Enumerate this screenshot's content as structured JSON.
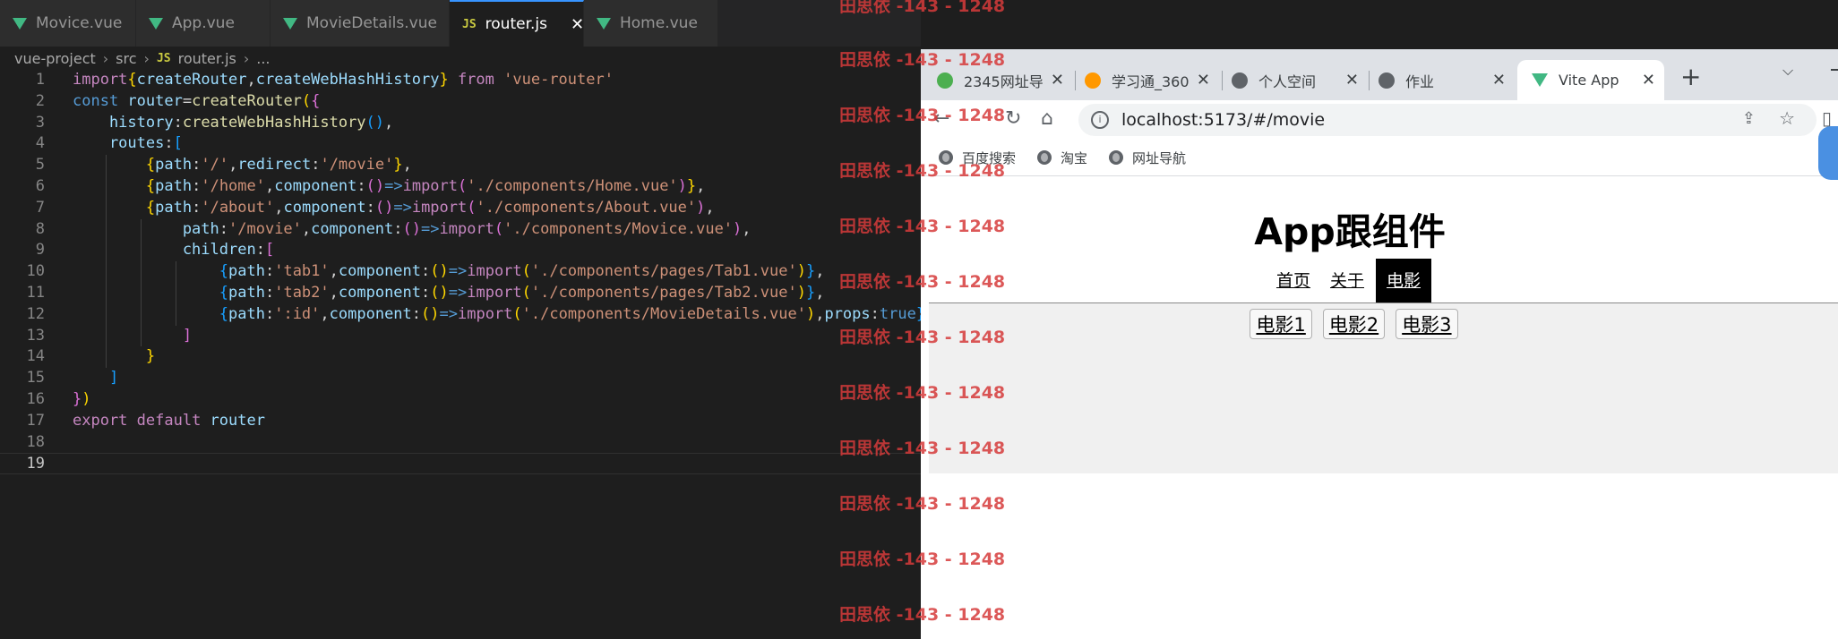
{
  "editor": {
    "tabs": [
      {
        "label": "Movice.vue",
        "icon": "vue-icon"
      },
      {
        "label": "App.vue",
        "icon": "vue-icon"
      },
      {
        "label": "MovieDetails.vue",
        "icon": "vue-icon"
      },
      {
        "label": "router.js",
        "icon": "js-icon",
        "active": true
      },
      {
        "label": "Home.vue",
        "icon": "vue-icon"
      }
    ],
    "breadcrumb": [
      "vue-project",
      "src",
      "router.js",
      "..."
    ],
    "breadcrumb_js_badge": "JS",
    "line_numbers": [
      "1",
      "2",
      "3",
      "4",
      "5",
      "6",
      "7",
      "8",
      "9",
      "10",
      "11",
      "12",
      "13",
      "14",
      "15",
      "16",
      "17",
      "18",
      "19"
    ],
    "colors": {
      "keyword": "#c586c0",
      "storage": "#569cd6",
      "function": "#dcdcaa",
      "string": "#ce9178",
      "property": "#9cdcfe",
      "punct": "#d4d4d4",
      "bracket1": "#ffd700",
      "bracket2": "#da70d6",
      "bracket3": "#179fff"
    }
  },
  "watermark": {
    "text": "田思依 -143 - 1248",
    "count": 12
  },
  "browser": {
    "tabs": [
      {
        "label": "2345网址导",
        "favicon": "2345-icon"
      },
      {
        "label": "学习通_360",
        "favicon": "360-icon"
      },
      {
        "label": "个人空间",
        "favicon": "globe-icon"
      },
      {
        "label": "作业",
        "favicon": "globe-icon"
      },
      {
        "label": "Vite App",
        "favicon": "vue-icon",
        "active": true
      }
    ],
    "new_tab": "+",
    "url": "localhost:5173/#/movie",
    "bookmarks": [
      "百度搜索",
      "淘宝",
      "网址导航"
    ],
    "page": {
      "title": "App跟组件",
      "nav": [
        {
          "label": "首页",
          "active": false
        },
        {
          "label": "关于",
          "active": false
        },
        {
          "label": "电影",
          "active": true
        }
      ],
      "movies": [
        "电影1",
        "电影2",
        "电影3"
      ]
    }
  }
}
